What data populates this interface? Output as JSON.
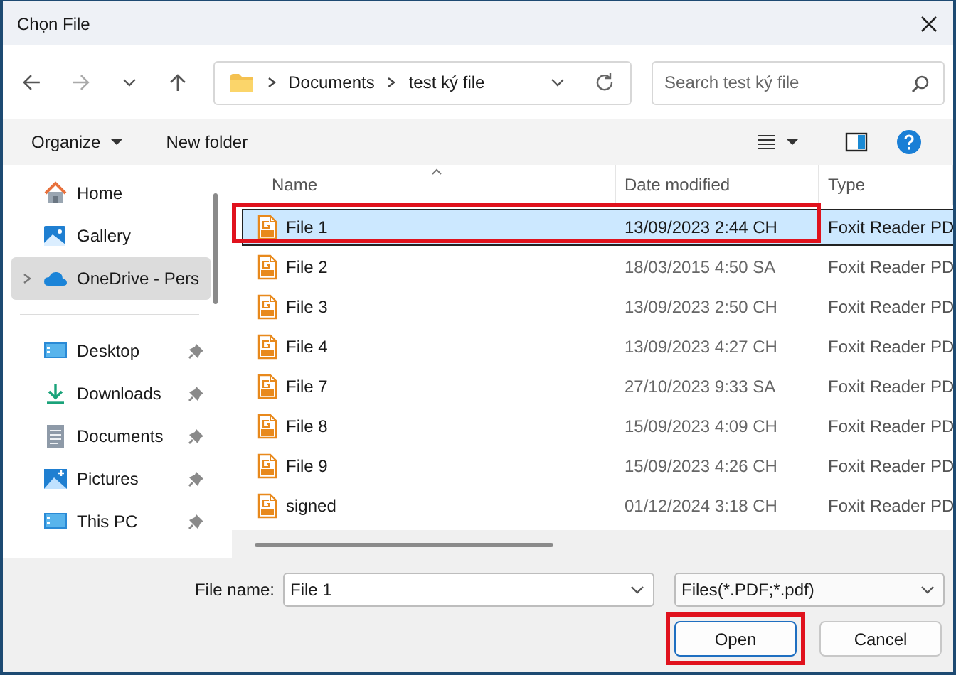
{
  "window": {
    "title": "Chọn File"
  },
  "address_bar": {
    "crumbs": [
      "Documents",
      "test ký file"
    ]
  },
  "search": {
    "placeholder": "Search test ký file"
  },
  "toolbar": {
    "organize": "Organize",
    "new_folder": "New folder"
  },
  "sidebar": {
    "items": [
      {
        "label": "Home",
        "kind": "home",
        "selected": false,
        "pinned": false,
        "expandable": false
      },
      {
        "label": "Gallery",
        "kind": "gallery",
        "selected": false,
        "pinned": false,
        "expandable": false
      },
      {
        "label": "OneDrive - Pers",
        "kind": "cloud",
        "selected": true,
        "pinned": false,
        "expandable": true
      },
      {
        "label": "Desktop",
        "kind": "desktop",
        "selected": false,
        "pinned": true,
        "expandable": false,
        "divider_before": true
      },
      {
        "label": "Downloads",
        "kind": "download",
        "selected": false,
        "pinned": true,
        "expandable": false
      },
      {
        "label": "Documents",
        "kind": "document",
        "selected": false,
        "pinned": true,
        "expandable": false
      },
      {
        "label": "Pictures",
        "kind": "picture",
        "selected": false,
        "pinned": true,
        "expandable": false
      },
      {
        "label": "This PC",
        "kind": "desktop",
        "selected": false,
        "pinned": true,
        "expandable": false
      }
    ]
  },
  "table": {
    "columns": [
      "Name",
      "Date modified",
      "Type"
    ],
    "rows": [
      {
        "name": "File 1",
        "date": "13/09/2023 2:44 CH",
        "type": "Foxit Reader PD",
        "selected": true,
        "annotated": true
      },
      {
        "name": "File 2",
        "date": "18/03/2015 4:50 SA",
        "type": "Foxit Reader PD",
        "selected": false,
        "annotated": false
      },
      {
        "name": "File 3",
        "date": "13/09/2023 2:50 CH",
        "type": "Foxit Reader PD",
        "selected": false,
        "annotated": false
      },
      {
        "name": "File 4",
        "date": "13/09/2023 4:27 CH",
        "type": "Foxit Reader PD",
        "selected": false,
        "annotated": false
      },
      {
        "name": "File 7",
        "date": "27/10/2023 9:33 SA",
        "type": "Foxit Reader PD",
        "selected": false,
        "annotated": false
      },
      {
        "name": "File 8",
        "date": "15/09/2023 4:09 CH",
        "type": "Foxit Reader PD",
        "selected": false,
        "annotated": false
      },
      {
        "name": "File 9",
        "date": "15/09/2023 4:26 CH",
        "type": "Foxit Reader PD",
        "selected": false,
        "annotated": false
      },
      {
        "name": "signed",
        "date": "01/12/2024 3:18 CH",
        "type": "Foxit Reader PD",
        "selected": false,
        "annotated": false
      }
    ]
  },
  "footer": {
    "file_name_label": "File name:",
    "file_name": "File 1",
    "filter": "Files(*.PDF;*.pdf)",
    "buttons": [
      {
        "label": "Open",
        "kind": "primary",
        "annotated": true
      },
      {
        "label": "Cancel",
        "kind": "normal",
        "annotated": false
      }
    ]
  }
}
